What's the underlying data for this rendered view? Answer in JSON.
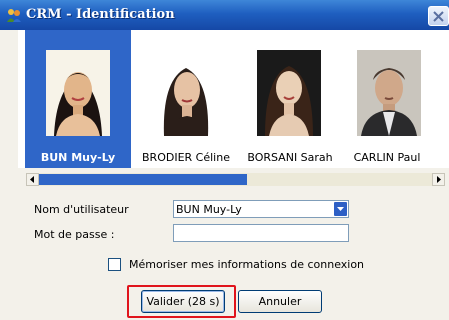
{
  "window": {
    "title": "CRM - Identification"
  },
  "users": [
    {
      "name": "BUN Muy-Ly",
      "selected": true
    },
    {
      "name": "BRODIER Céline",
      "selected": false
    },
    {
      "name": "BORSANI Sarah",
      "selected": false
    },
    {
      "name": "CARLIN Paul",
      "selected": false
    }
  ],
  "form": {
    "username_label": "Nom d'utilisateur",
    "username_value": "BUN Muy-Ly",
    "password_label": "Mot de passe :",
    "password_value": "",
    "remember_label": "Mémoriser mes informations de connexion",
    "remember_checked": false
  },
  "buttons": {
    "ok_label": "Valider (28 s)",
    "cancel_label": "Annuler"
  },
  "colors": {
    "titlebar": "#1f5fc0",
    "selection": "#2f66c8",
    "focus_ring": "#e0141c"
  }
}
